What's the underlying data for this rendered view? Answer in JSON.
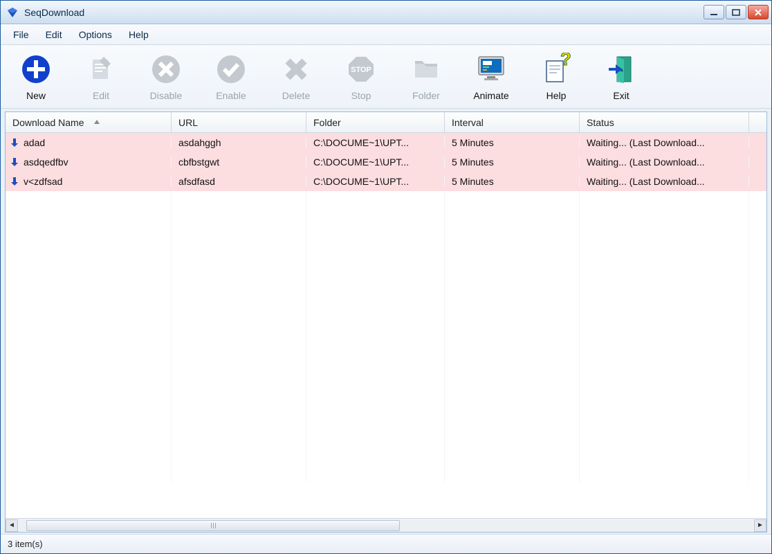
{
  "window": {
    "title": "SeqDownload"
  },
  "menu": {
    "file": "File",
    "edit": "Edit",
    "options": "Options",
    "help": "Help"
  },
  "toolbar": {
    "new": "New",
    "edit": "Edit",
    "disable": "Disable",
    "enable": "Enable",
    "delete": "Delete",
    "stop": "Stop",
    "folder": "Folder",
    "animate": "Animate",
    "help": "Help",
    "exit": "Exit"
  },
  "columns": {
    "name": "Download Name",
    "url": "URL",
    "folder": "Folder",
    "interval": "Interval",
    "status": "Status"
  },
  "rows": [
    {
      "name": "adad",
      "url": "asdahggh",
      "folder": "C:\\DOCUME~1\\UPT...",
      "interval": "5 Minutes",
      "status": "Waiting... (Last Download..."
    },
    {
      "name": "asdqedfbv",
      "url": "cbfbstgwt",
      "folder": "C:\\DOCUME~1\\UPT...",
      "interval": "5 Minutes",
      "status": "Waiting... (Last Download..."
    },
    {
      "name": "v<zdfsad",
      "url": "afsdfasd",
      "folder": "C:\\DOCUME~1\\UPT...",
      "interval": "5 Minutes",
      "status": "Waiting... (Last Download..."
    }
  ],
  "status": {
    "text": "3 item(s)"
  },
  "colors": {
    "row_bg": "#fcdde0",
    "accent_blue": "#1040cc",
    "disabled_gray": "#c3c9cf"
  }
}
